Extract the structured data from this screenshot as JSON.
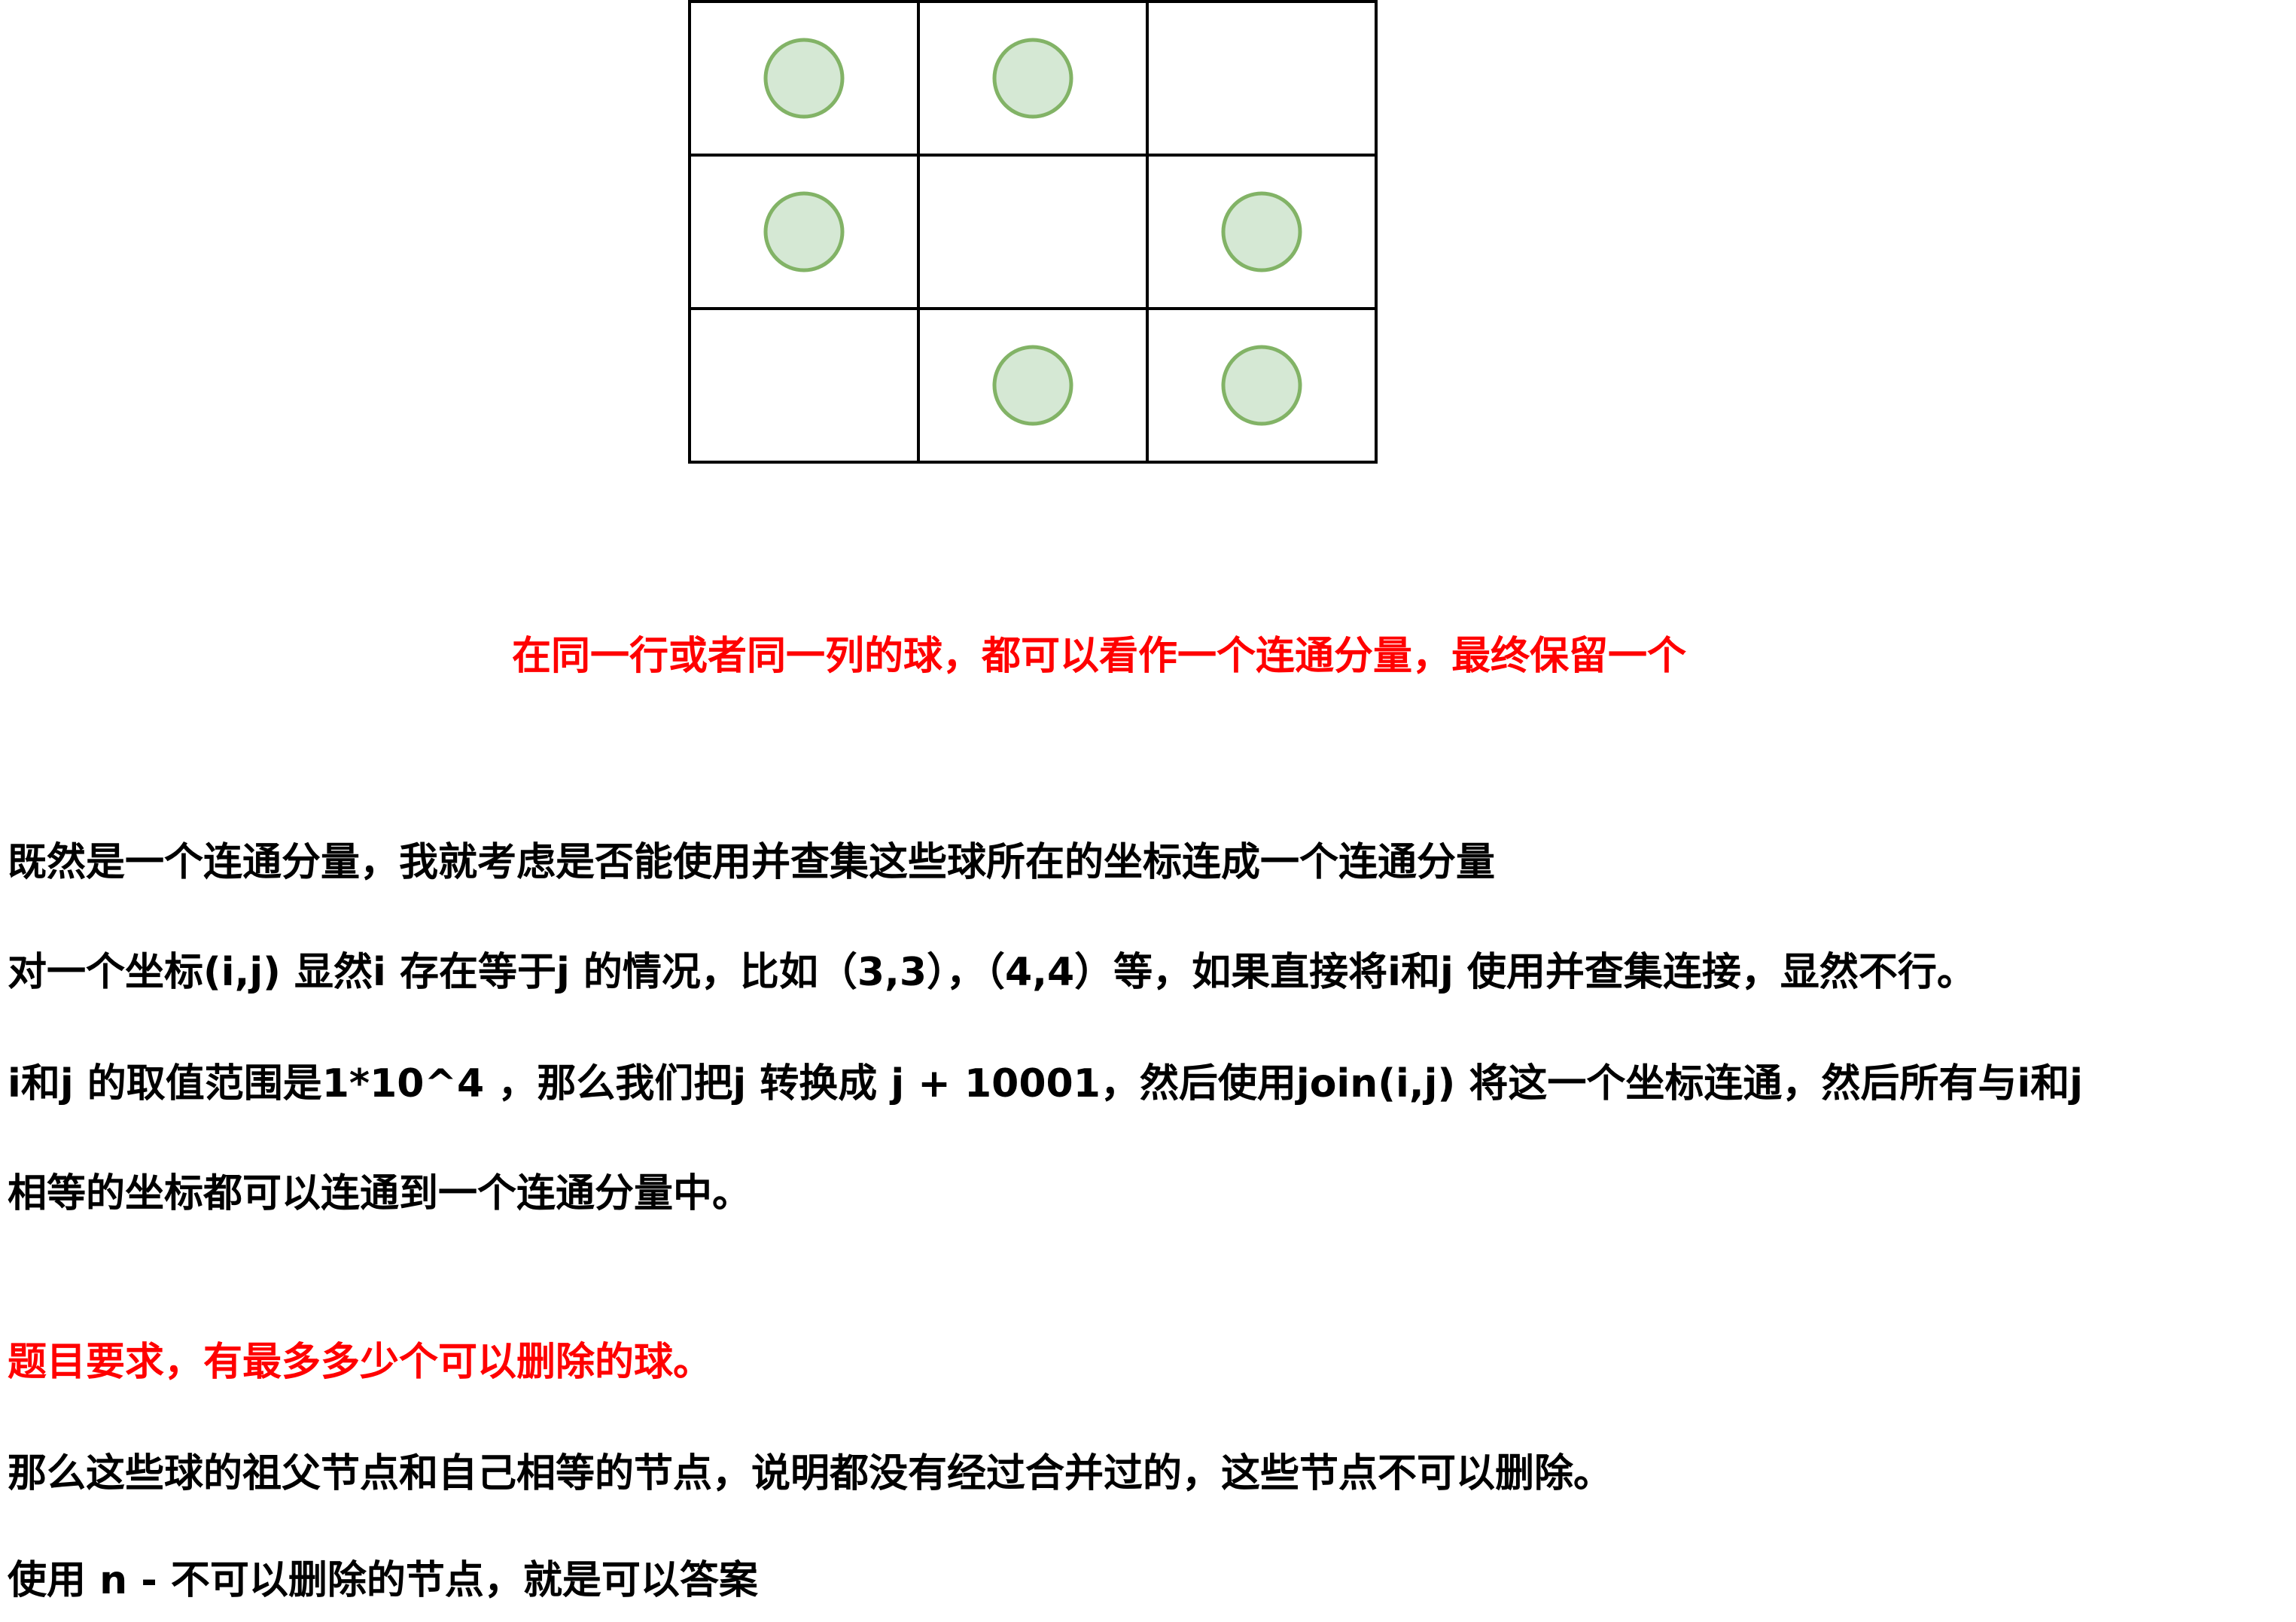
{
  "grid": {
    "rows": 3,
    "cols": 3,
    "balls": [
      [
        0,
        0
      ],
      [
        0,
        1
      ],
      [
        1,
        0
      ],
      [
        1,
        2
      ],
      [
        2,
        1
      ],
      [
        2,
        2
      ]
    ],
    "colors": {
      "ball_fill": "#d5e8d4",
      "ball_stroke": "#82b366",
      "border": "#000000"
    }
  },
  "text": {
    "heading": "在同一行或者同一列的球，都可以看作一个连通分量，最终保留一个",
    "line1": "既然是一个连通分量，我就考虑是否能使用并查集这些球所在的坐标连成一个连通分量",
    "line2": "对一个坐标(i,j) 显然i 存在等于j 的情况，比如（3,3），（4,4）等，如果直接将i和j 使用并查集连接，显然不行。",
    "line3": "i和j 的取值范围是1*10^4 ，那么我们把j 转换成 j + 10001，然后使用join(i,j) 将这一个坐标连通，然后所有与i和j",
    "line4": "相等的坐标都可以连通到一个连通分量中。",
    "line5": "题目要求，有最多多少个可以删除的球。",
    "line6": "那么这些球的祖父节点和自己相等的节点，说明都没有经过合并过的，这些节点不可以删除。",
    "line7": "使用 n - 不可以删除的节点，就是可以答案"
  },
  "colors": {
    "highlight": "#ff0000",
    "text": "#000000"
  }
}
